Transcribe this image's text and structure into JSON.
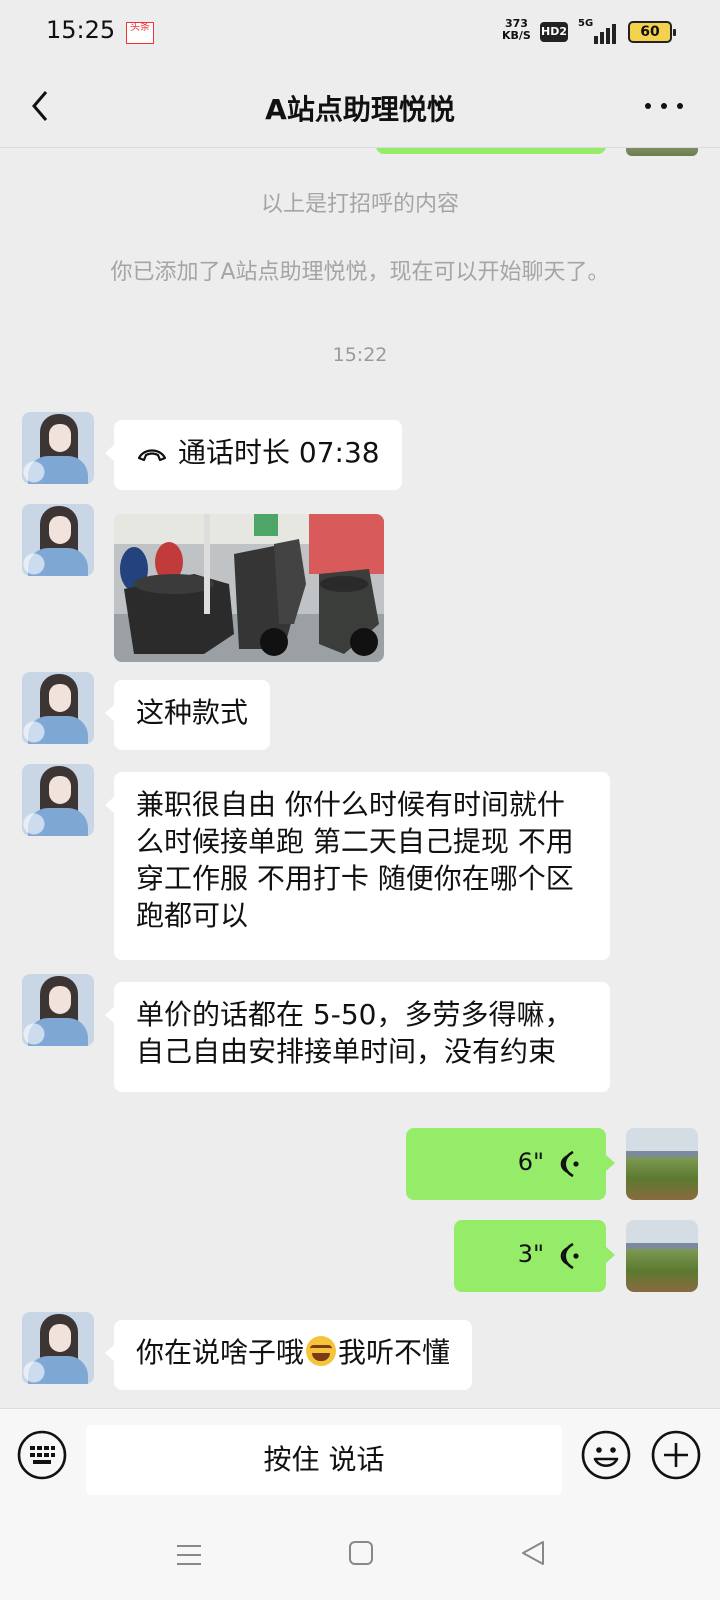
{
  "status_bar": {
    "time": "15:25",
    "app_badge": "头条",
    "speed_value": "373",
    "speed_unit": "KB/S",
    "hd_badge": "HD2",
    "network": "5G",
    "battery": "60"
  },
  "header": {
    "title": "A站点助理悦悦",
    "back_icon": "chevron-left-icon",
    "more_icon": "more-dots-icon"
  },
  "chat": {
    "system_greeting_note": "以上是打招呼的内容",
    "system_added_note": "你已添加了A站点助理悦悦，现在可以开始聊天了。",
    "timestamp": "15:22",
    "messages": [
      {
        "sender": "other",
        "type": "call",
        "text": "通话时长 07:38"
      },
      {
        "sender": "other",
        "type": "image"
      },
      {
        "sender": "other",
        "type": "text",
        "text": "这种款式"
      },
      {
        "sender": "other",
        "type": "text",
        "text": "兼职很自由 你什么时候有时间就什么时候接单跑 第二天自己提现 不用穿工作服 不用打卡 随便你在哪个区跑都可以"
      },
      {
        "sender": "other",
        "type": "text",
        "text": "单价的话都在 5-50，多劳多得嘛，自己自由安排接单时间，没有约束"
      },
      {
        "sender": "self",
        "type": "voice",
        "duration": "6\""
      },
      {
        "sender": "self",
        "type": "voice",
        "duration": "3\""
      },
      {
        "sender": "other",
        "type": "text",
        "text_before": "你在说啥子哦",
        "emoji": "crying-laughing-emoji",
        "text_after": "我听不懂"
      }
    ]
  },
  "input_bar": {
    "hold_to_talk": "按住 说话",
    "keyboard_icon": "keyboard-icon",
    "emoji_icon": "smiley-icon",
    "plus_icon": "plus-circle-icon"
  },
  "nav_bar": {
    "menu_icon": "menu-icon",
    "home_icon": "home-square-icon",
    "back_icon": "back-triangle-icon"
  },
  "colors": {
    "background": "#ededed",
    "self_bubble": "#95ec69",
    "other_bubble": "#ffffff",
    "system_text": "#a5a5a5"
  }
}
